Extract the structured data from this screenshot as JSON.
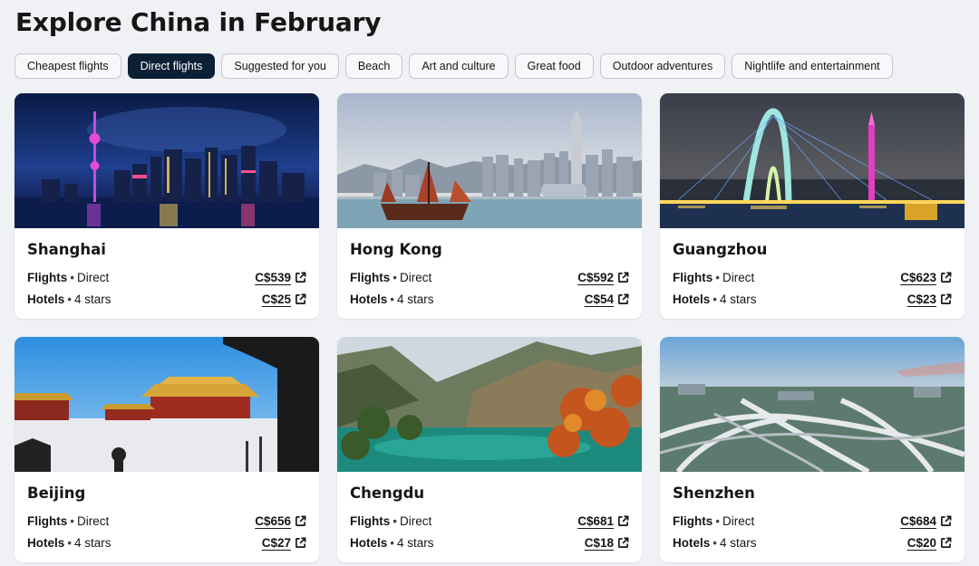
{
  "page": {
    "title": "Explore China in February"
  },
  "filters": [
    {
      "label": "Cheapest flights",
      "active": false
    },
    {
      "label": "Direct flights",
      "active": true
    },
    {
      "label": "Suggested for you",
      "active": false
    },
    {
      "label": "Beach",
      "active": false
    },
    {
      "label": "Art and culture",
      "active": false
    },
    {
      "label": "Great food",
      "active": false
    },
    {
      "label": "Outdoor adventures",
      "active": false
    },
    {
      "label": "Nightlife and entertainment",
      "active": false
    }
  ],
  "labels": {
    "flights": "Flights",
    "hotels": "Hotels",
    "dot": "•"
  },
  "cards": [
    {
      "city": "Shanghai",
      "flight_type": "Direct",
      "flight_price": "C$539",
      "hotel_stars": "4 stars",
      "hotel_price": "C$25",
      "image": "shanghai-skyline-night"
    },
    {
      "city": "Hong Kong",
      "flight_type": "Direct",
      "flight_price": "C$592",
      "hotel_stars": "4 stars",
      "hotel_price": "C$54",
      "image": "hong-kong-harbour-junk-boat"
    },
    {
      "city": "Guangzhou",
      "flight_type": "Direct",
      "flight_price": "C$623",
      "hotel_stars": "4 stars",
      "hotel_price": "C$23",
      "image": "guangzhou-bridge-canton-tower"
    },
    {
      "city": "Beijing",
      "flight_type": "Direct",
      "flight_price": "C$656",
      "hotel_stars": "4 stars",
      "hotel_price": "C$27",
      "image": "beijing-forbidden-city-snow"
    },
    {
      "city": "Chengdu",
      "flight_type": "Direct",
      "flight_price": "C$681",
      "hotel_stars": "4 stars",
      "hotel_price": "C$18",
      "image": "chengdu-jiuzhaigou-lake"
    },
    {
      "city": "Shenzhen",
      "flight_type": "Direct",
      "flight_price": "C$684",
      "hotel_stars": "4 stars",
      "hotel_price": "C$20",
      "image": "shenzhen-highway-interchange"
    }
  ],
  "icons": {
    "external_link": "external-link-icon"
  },
  "colors": {
    "active_chip": "#0b1f35",
    "background": "#eff1f5"
  }
}
